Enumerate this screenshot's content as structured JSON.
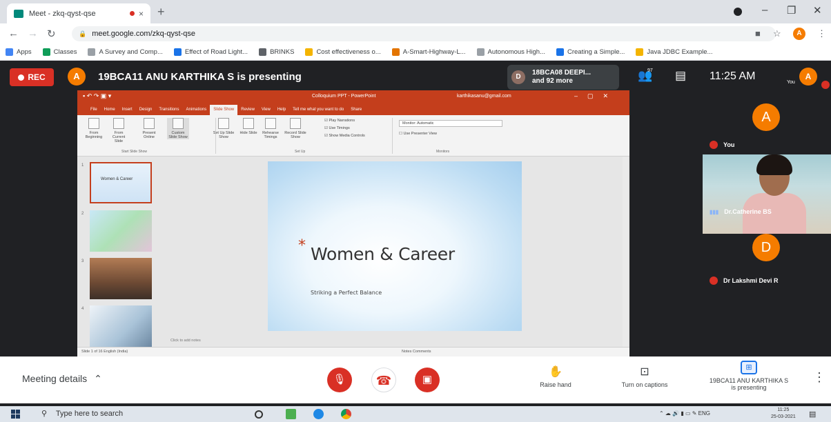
{
  "browser": {
    "tab_title": "Meet - zkq-qyst-qse",
    "new_tab": "+",
    "tab_close": "×",
    "url": "meet.google.com/zkq-qyst-qse",
    "profile_initial": "A",
    "bookmarks": [
      {
        "label": "Apps",
        "icon": "apps-grid-icon",
        "color": "#4285f4"
      },
      {
        "label": "Classes",
        "icon": "classroom-icon",
        "color": "#0f9d58"
      },
      {
        "label": "A Survey and Comp...",
        "icon": "doc-icon",
        "color": "#9aa0a6"
      },
      {
        "label": "Effect of Road Light...",
        "icon": "doc-icon",
        "color": "#1a73e8"
      },
      {
        "label": "BRINKS",
        "icon": "globe-icon",
        "color": "#5f6368"
      },
      {
        "label": "Cost effectiveness o...",
        "icon": "doc-icon",
        "color": "#f4b400"
      },
      {
        "label": "A-Smart-Highway-L...",
        "icon": "doc-icon",
        "color": "#e37400"
      },
      {
        "label": "Autonomous High...",
        "icon": "doc-icon",
        "color": "#9aa0a6"
      },
      {
        "label": "Creating a Simple...",
        "icon": "doc-icon",
        "color": "#1a73e8"
      },
      {
        "label": "Java JDBC Example...",
        "icon": "doc-icon",
        "color": "#f4b400"
      }
    ]
  },
  "meet": {
    "rec_label": "REC",
    "presenter_initial": "A",
    "presenting_title": "19BCA11 ANU KARTHIKA S is presenting",
    "others_initial": "D",
    "others_line1": "18BCA08 DEEPI...",
    "others_line2": "and 92 more",
    "people_count": "97",
    "time": "11:25 AM",
    "you_small": "You",
    "you_initial": "A"
  },
  "ppt": {
    "title": "Colloquium PPT - PowerPoint",
    "account": "karthikasanu@gmail.com",
    "menu": [
      "File",
      "Home",
      "Insert",
      "Design",
      "Transitions",
      "Animations",
      "Slide Show",
      "Review",
      "View",
      "Help",
      "Tell me what you want to do",
      "Share"
    ],
    "active_menu_index": 6,
    "ribbon_buttons": [
      {
        "label": "From Beginning"
      },
      {
        "label": "From Current Slide"
      },
      {
        "label": "Present Online"
      },
      {
        "label": "Custom Slide Show"
      },
      {
        "label": "Set Up Slide Show"
      },
      {
        "label": "Hide Slide"
      },
      {
        "label": "Rehearse Timings"
      },
      {
        "label": "Record Slide Show"
      }
    ],
    "ribbon_checks": [
      "Play Narrations",
      "Use Timings",
      "Show Media Controls"
    ],
    "monitor_label": "Monitor: Automatic",
    "presenter_view": "Use Presenter View",
    "groups": [
      "Start Slide Show",
      "Set Up",
      "Monitors"
    ],
    "thumb1_text": "Women & Career",
    "slide_star": "*",
    "slide_title": "Women & Career",
    "slide_subtitle": "Striking a Perfect Balance",
    "notes_hint": "Click to add notes",
    "status_left": "Slide 1 of 16   English (India)",
    "status_right": "Notes   Comments",
    "thumb_numbers": [
      "1",
      "2",
      "3",
      "4"
    ]
  },
  "participants": [
    {
      "name": "You",
      "initial": "A",
      "color": "#f57c00",
      "muted": true
    },
    {
      "name": "Dr.Catherine BS",
      "muted": false
    },
    {
      "name": "Dr Lakshmi Devi R",
      "initial": "D",
      "color": "#f57c00",
      "muted": true
    }
  ],
  "bottom": {
    "meeting_details": "Meeting details",
    "raise_hand": "Raise hand",
    "captions": "Turn on captions",
    "presenting_line1": "19BCA11 ANU KARTHIKA S",
    "presenting_line2": "is presenting",
    "kebab": "⋮"
  },
  "taskbar": {
    "search_placeholder": "Type here to search",
    "lang": "ENG",
    "time": "11:25",
    "date": "25-03-2021"
  }
}
